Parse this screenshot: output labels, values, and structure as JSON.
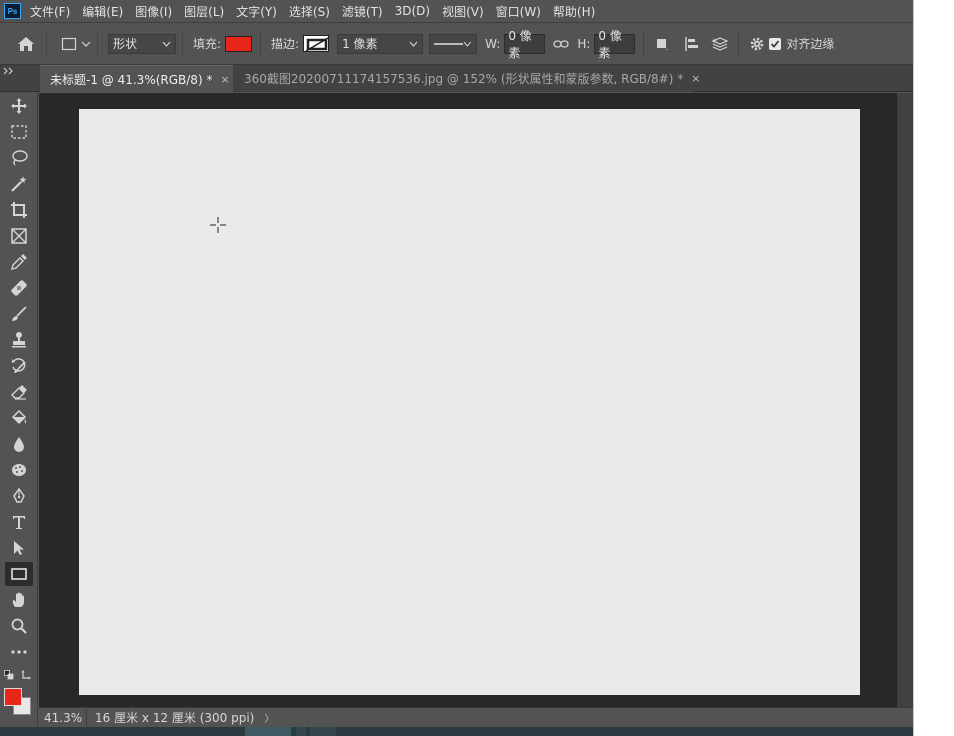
{
  "app": {
    "logo_text": "Ps",
    "menu": [
      "文件(F)",
      "编辑(E)",
      "图像(I)",
      "图层(L)",
      "文字(Y)",
      "选择(S)",
      "滤镜(T)",
      "3D(D)",
      "视图(V)",
      "窗口(W)",
      "帮助(H)"
    ]
  },
  "options": {
    "mode_value": "形状",
    "fill_label": "填充:",
    "fill_color": "#e8261a",
    "stroke_label": "描边:",
    "stroke_width_value": "1 像素",
    "w_label": "W:",
    "w_value": "0 像素",
    "h_label": "H:",
    "h_value": "0 像素",
    "align_edges_label": "对齐边缘",
    "align_edges_checked": true
  },
  "tabs": [
    {
      "label": "未标题-1 @ 41.3%(RGB/8) *",
      "active": true
    },
    {
      "label": "360截图20200711174157536.jpg @ 152% (形状属性和蒙版参数, RGB/8#) *",
      "active": false
    }
  ],
  "toolbar": {
    "selected_tool": "rectangle-tool",
    "foreground_color": "#e8261a",
    "background_color": "#e8e8e8"
  },
  "status": {
    "zoom": "41.3%",
    "doc_info": "16 厘米 x 12 厘米 (300 ppi)",
    "arrow": "〉"
  }
}
